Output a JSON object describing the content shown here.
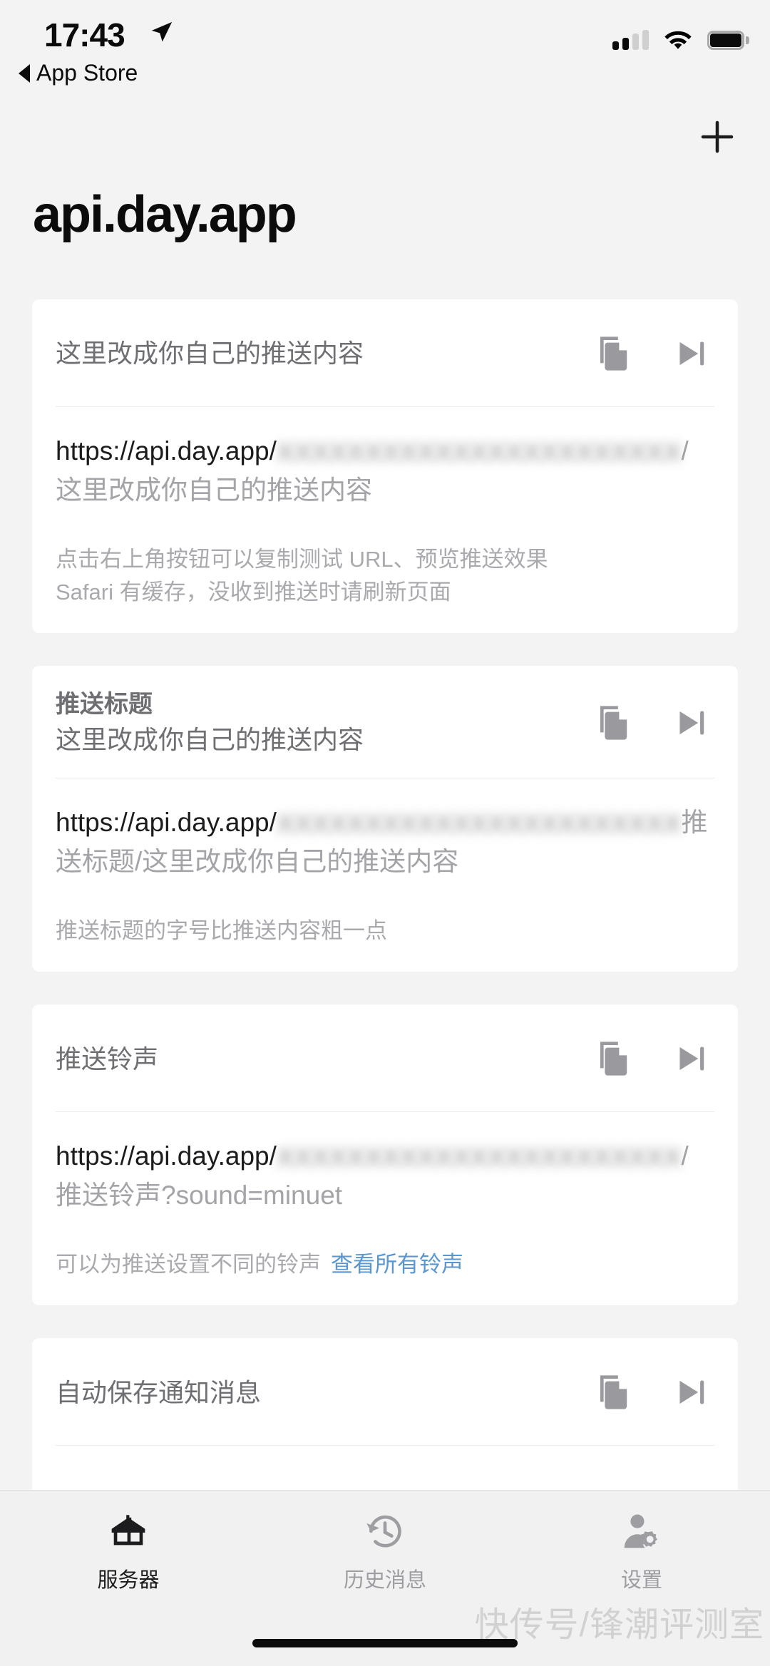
{
  "status_bar": {
    "time": "17:43",
    "location_icon": "location-arrow-icon",
    "back_label": "App Store",
    "cellular_icon": "cellular-signal-icon",
    "cellular_bars_filled": 2,
    "cellular_bars_total": 4,
    "wifi_icon": "wifi-icon",
    "battery_icon": "battery-full-icon"
  },
  "nav": {
    "add_label": "+",
    "add_icon": "plus-icon"
  },
  "header": {
    "title": "api.day.app"
  },
  "cards": [
    {
      "title": "",
      "subtitle": "这里改成你自己的推送内容",
      "copy_icon": "copy-icon",
      "preview_icon": "skip-forward-icon",
      "url_prefix": "https://api.day.app/",
      "url_token_blurred": "XXXXXXXXXXXXXXXXXXXXXXX",
      "url_suffix": "/这里改成你自己的推送内容",
      "hint": "点击右上角按钮可以复制测试 URL、预览推送效果\nSafari 有缓存，没收到推送时请刷新页面",
      "hint_link": ""
    },
    {
      "title": "推送标题",
      "subtitle": "这里改成你自己的推送内容",
      "copy_icon": "copy-icon",
      "preview_icon": "skip-forward-icon",
      "url_prefix": "https://api.day.app/",
      "url_token_blurred": "XXXXXXXXXXXXXXXXXXXXXXX",
      "url_suffix": "推送标题/这里改成你自己的推送内容",
      "hint": "推送标题的字号比推送内容粗一点",
      "hint_link": ""
    },
    {
      "title": "",
      "subtitle": "推送铃声",
      "copy_icon": "copy-icon",
      "preview_icon": "skip-forward-icon",
      "url_prefix": "https://api.day.app/",
      "url_token_blurred": "XXXXXXXXXXXXXXXXXXXXXXX",
      "url_suffix": "/推送铃声?sound=minuet",
      "hint": "可以为推送设置不同的铃声",
      "hint_link": "查看所有铃声"
    },
    {
      "title": "",
      "subtitle": "自动保存通知消息",
      "copy_icon": "copy-icon",
      "preview_icon": "skip-forward-icon",
      "url_prefix": "",
      "url_token_blurred": "",
      "url_suffix": "",
      "hint": "",
      "hint_link": ""
    }
  ],
  "tabbar": {
    "items": [
      {
        "label": "服务器",
        "icon": "home-icon",
        "active": true
      },
      {
        "label": "历史消息",
        "icon": "history-clock-icon",
        "active": false
      },
      {
        "label": "设置",
        "icon": "person-gear-icon",
        "active": false
      }
    ]
  },
  "watermark": "快传号/锋潮评测室",
  "colors": {
    "background": "#f3f3f3",
    "card": "#ffffff",
    "primary_text": "#1c1c1e",
    "secondary_text": "#6e6e73",
    "muted_text": "#a9a9ae",
    "link": "#5a96cf",
    "icon": "#9a9a9e"
  }
}
